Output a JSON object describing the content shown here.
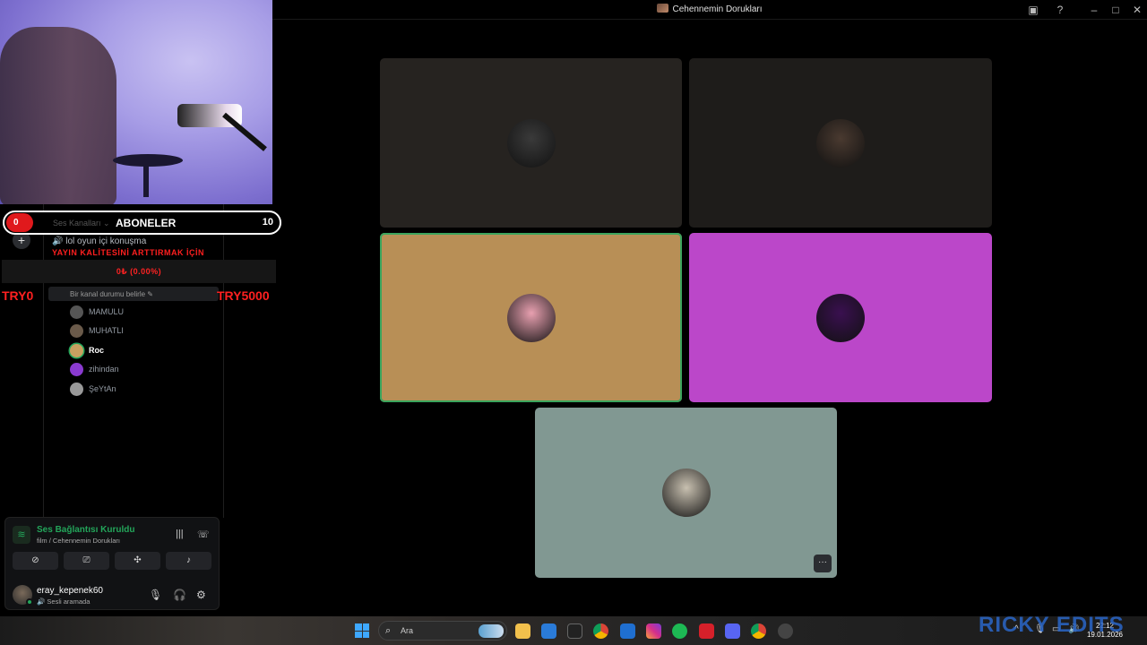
{
  "window": {
    "title": "Cehennemin Dorukları",
    "icons": [
      "inbox-icon",
      "help-icon",
      "minimize-icon",
      "maximize-icon",
      "close-icon"
    ]
  },
  "overlay": {
    "sub_count": "0",
    "faint_label": "Ses Kanalları ⌄",
    "sub_label": "ABONELER",
    "sub_goal": "10",
    "warning": "YAYIN KALİTESİNİ ARTTIRMAK İÇİN",
    "progress_text": "0₺ (0.00%)",
    "progress_value": 0,
    "try_left": "TRY0",
    "try_right": "TRY5000"
  },
  "channels": {
    "voice_channel": "🔊 lol oyun içi konuşma",
    "status_prompt": "Bir kanal durumu belirle ✎",
    "members": [
      {
        "name": "MAMULU",
        "active": false,
        "color": "#555"
      },
      {
        "name": "MUHATLI",
        "active": false,
        "color": "#6a5a4a"
      },
      {
        "name": "Roc",
        "active": true,
        "color": "#c8a060"
      },
      {
        "name": "zihindan",
        "active": false,
        "color": "#8a3ad0"
      },
      {
        "name": "ŞeYtAn",
        "active": false,
        "color": "#999"
      }
    ]
  },
  "voice_panel": {
    "status": "Ses Bağlantısı Kuruldu",
    "channel_path": "film / Cehennemin Dorukları",
    "username": "eray_kepenek60",
    "user_status": "🔊 Sesli aramada",
    "buttons": [
      "camera-off-button",
      "screen-share-button",
      "activities-button",
      "soundboard-button"
    ],
    "button_glyphs": [
      "⊘",
      "⎚",
      "✣",
      "♪"
    ]
  },
  "tiles": [
    {
      "name": "participant-1",
      "bg": "#262320",
      "avatar": "#3a3a3a",
      "speaking": false
    },
    {
      "name": "participant-2",
      "bg": "#1e1c1a",
      "avatar": "#4a3a30",
      "speaking": false
    },
    {
      "name": "participant-3",
      "bg": "#b88f56",
      "avatar": "#e8a0b0",
      "speaking": true
    },
    {
      "name": "participant-4",
      "bg": "#bb47c9",
      "avatar": "#3a1050",
      "speaking": false
    },
    {
      "name": "participant-5",
      "bg": "#819892",
      "avatar": "#c8c0b0",
      "speaking": false
    }
  ],
  "taskbar": {
    "search_placeholder": "Ara",
    "time": "22:12",
    "date": "19.01.2026",
    "watermark": "RICKY EDITS"
  }
}
